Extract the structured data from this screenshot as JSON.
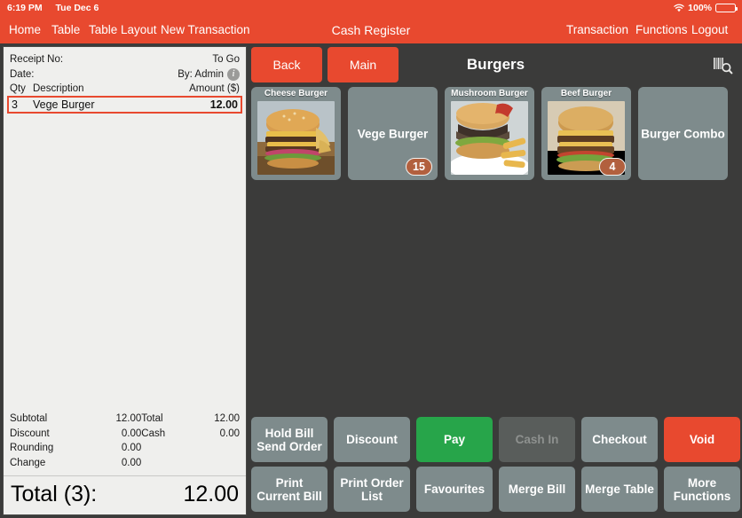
{
  "status_bar": {
    "time": "6:19 PM",
    "date": "Tue Dec 6",
    "wifi_icon": "wifi-icon",
    "battery_percent": "100%"
  },
  "nav": {
    "title": "Cash Register",
    "left_items": [
      {
        "label": "Home",
        "name": "nav-home"
      },
      {
        "label": "Table",
        "name": "nav-table"
      },
      {
        "label": "Table Layout",
        "name": "nav-table-layout"
      },
      {
        "label": "New Transaction",
        "name": "nav-new-transaction"
      }
    ],
    "right_items": [
      {
        "label": "Transaction",
        "name": "nav-transaction"
      },
      {
        "label": "Functions",
        "name": "nav-functions"
      },
      {
        "label": "Logout",
        "name": "nav-logout"
      }
    ]
  },
  "receipt": {
    "receipt_no_label": "Receipt No:",
    "receipt_no_value": "",
    "order_type": "To Go",
    "date_label": "Date:",
    "date_value": "",
    "by_label": "By: Admin",
    "info_icon": "info-icon",
    "col_qty": "Qty",
    "col_description": "Description",
    "col_amount": "Amount ($)",
    "items": [
      {
        "qty": "3",
        "description": "Vege Burger",
        "amount": "12.00",
        "selected": true
      }
    ],
    "totals_left": [
      {
        "label": "Subtotal",
        "value": "12.00"
      },
      {
        "label": "Discount",
        "value": "0.00"
      },
      {
        "label": "Rounding",
        "value": "0.00"
      },
      {
        "label": "Change",
        "value": "0.00"
      }
    ],
    "totals_right": [
      {
        "label": "Total",
        "value": "12.00"
      },
      {
        "label": "Cash",
        "value": "0.00"
      }
    ],
    "grand_total_label": "Total (3):",
    "grand_total_value": "12.00"
  },
  "panel": {
    "back_label": "Back",
    "main_label": "Main",
    "category_title": "Burgers",
    "scan_icon": "barcode-search-icon"
  },
  "products": [
    {
      "name": "Cheese Burger",
      "has_image": true,
      "image": "cheese-burger-photo",
      "badge": null
    },
    {
      "name": "Vege Burger",
      "has_image": false,
      "image": null,
      "badge": "15"
    },
    {
      "name": "Mushroom Burger",
      "has_image": true,
      "image": "mushroom-burger-photo",
      "badge": null
    },
    {
      "name": "Beef Burger",
      "has_image": true,
      "image": "beef-burger-photo",
      "badge": "4"
    },
    {
      "name": "Burger Combo",
      "has_image": false,
      "image": null,
      "badge": null
    }
  ],
  "actions_row1": [
    {
      "label": "Hold Bill\nSend Order",
      "style": "normal",
      "name": "hold-bill-send-order-button"
    },
    {
      "label": "Discount",
      "style": "normal",
      "name": "discount-button"
    },
    {
      "label": "Pay",
      "style": "green",
      "name": "pay-button"
    },
    {
      "label": "Cash In",
      "style": "disabled",
      "name": "cash-in-button"
    },
    {
      "label": "Checkout",
      "style": "normal",
      "name": "checkout-button"
    },
    {
      "label": "Void",
      "style": "red",
      "name": "void-button"
    }
  ],
  "actions_row2": [
    {
      "label": "Print\nCurrent Bill",
      "style": "normal",
      "name": "print-current-bill-button"
    },
    {
      "label": "Print Order\nList",
      "style": "normal",
      "name": "print-order-list-button"
    },
    {
      "label": "Favourites",
      "style": "normal",
      "name": "favourites-button"
    },
    {
      "label": "Merge Bill",
      "style": "normal",
      "name": "merge-bill-button"
    },
    {
      "label": "Merge Table",
      "style": "normal",
      "name": "merge-table-button"
    },
    {
      "label": "More\nFunctions",
      "style": "normal",
      "name": "more-functions-button"
    }
  ],
  "colors": {
    "brand_red": "#e8492f",
    "panel_dark": "#3b3b3a",
    "tile_slate": "#7e8b8c",
    "pay_green": "#27a54a",
    "badge_brown": "#b2603e",
    "receipt_paper": "#efefed"
  }
}
